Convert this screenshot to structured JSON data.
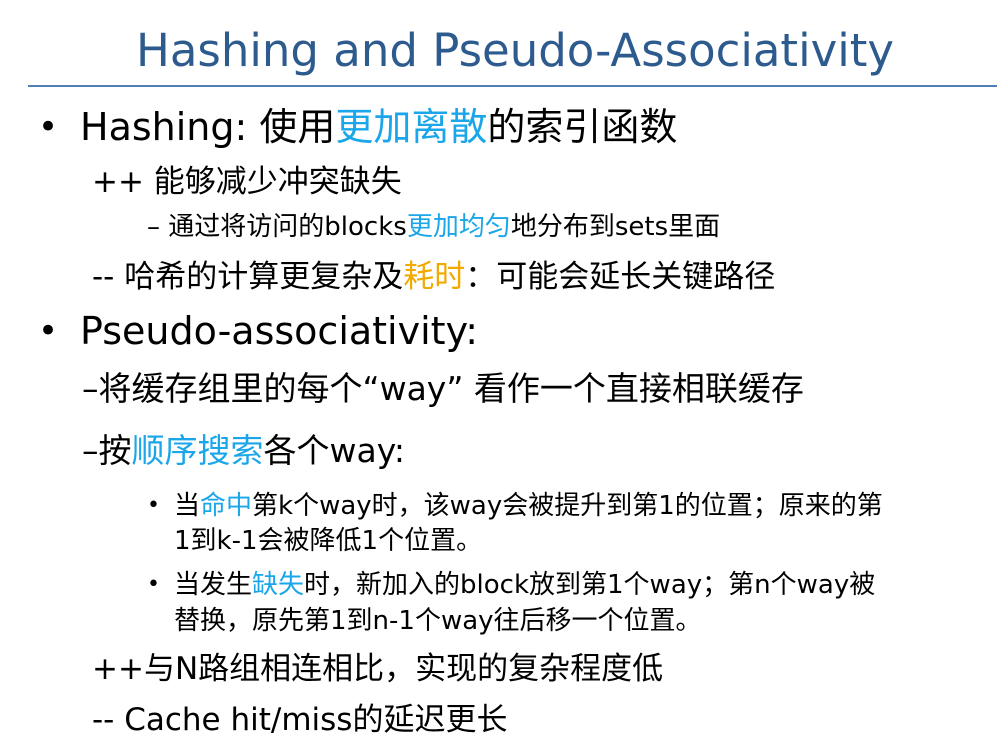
{
  "title": "Hashing and Pseudo-Associativity",
  "colors": {
    "title": "#2e5b8e",
    "rule": "#4f7fb5",
    "highlight_blue": "#1aa6e8",
    "highlight_orange": "#f2a900"
  },
  "items": {
    "hashing": {
      "bullet": "•",
      "prefix": "Hashing: 使用",
      "highlight": "更加离散",
      "suffix": "的索引函数"
    },
    "pro1": {
      "text": "++ 能够减少冲突缺失"
    },
    "pro1_sub": {
      "prefix": "– 通过将访问的blocks",
      "highlight": "更加均匀",
      "suffix": "地分布到sets里面"
    },
    "con1": {
      "prefix": "-- 哈希的计算更复杂及",
      "highlight": "耗时",
      "suffix": "：可能会延长关键路径"
    },
    "pseudo": {
      "bullet": "•",
      "text": "Pseudo-associativity:"
    },
    "pseudo_dash1": {
      "text": "–将缓存组里的每个“way” 看作一个直接相联缓存"
    },
    "pseudo_dash2": {
      "prefix": "–按",
      "highlight": "顺序搜索",
      "suffix": "各个way:"
    },
    "hit": {
      "bullet": "•",
      "line1_prefix": "当",
      "line1_highlight": "命中",
      "line1_suffix": "第k个way时，该way会被提升到第1的位置；原来的第",
      "line2": "1到k-1会被降低1个位置。"
    },
    "miss": {
      "bullet": "•",
      "line1_prefix": "当发生",
      "line1_highlight": "缺失",
      "line1_suffix": "时，新加入的block放到第1个way；第n个way被",
      "line2": "替换，原先第1到n-1个way往后移一个位置。"
    },
    "pro2": {
      "text": "++与N路组相连相比，实现的复杂程度低"
    },
    "con2": {
      "text": "-- Cache hit/miss的延迟更长"
    }
  }
}
